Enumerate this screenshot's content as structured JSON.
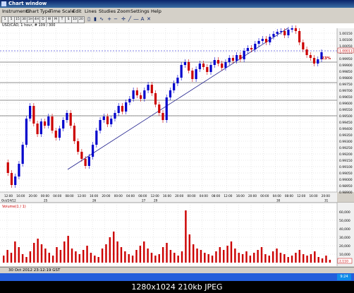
{
  "window": {
    "title": "Chart window"
  },
  "menu": [
    "Instruments",
    "Chart Type",
    "Time Scale",
    "Edit",
    "Lines",
    "Studies",
    "Zoom",
    "Settings",
    "Help"
  ],
  "toolbar": {
    "timeframes": [
      "1",
      "5",
      "15",
      "30",
      "1H",
      "4H",
      "D",
      "W",
      "M",
      "T",
      "S",
      "10",
      "20"
    ]
  },
  "chart": {
    "info": "USD/CAD, 1 hour, # 109 / 300",
    "price_labels": [
      "1.00150",
      "1.00100",
      "1.00050",
      "1.00000",
      "0.99950",
      "0.99900",
      "0.99850",
      "0.99800",
      "0.99750",
      "0.99700",
      "0.99650",
      "0.99600",
      "0.99550",
      "0.99500",
      "0.99450",
      "0.99400",
      "0.99350",
      "0.99300",
      "0.99250",
      "0.99200",
      "0.99150",
      "0.99100",
      "0.99050",
      "0.99000",
      "0.98950",
      "0.98900"
    ],
    "current_price": "1.00011",
    "annotation": "23%",
    "time_labels": [
      "12:00",
      "16:00",
      "20:00",
      "00:00",
      "04:00",
      "08:00",
      "12:00",
      "16:00",
      "20:00",
      "00:00",
      "04:00",
      "08:00",
      "12:00",
      "16:00",
      "20:00",
      "00:00",
      "04:00",
      "08:00",
      "12:00",
      "16:00",
      "20:00",
      "00:00",
      "04:00",
      "08:00",
      "12:00",
      "16:00",
      "20:00"
    ],
    "date_labels": [
      "Oct/24/12",
      "25",
      "26",
      "27",
      "29",
      "30",
      "31"
    ],
    "bull_color": "#0000cc",
    "bear_color": "#cc0000",
    "trendline_color": "#1e1e8c"
  },
  "volume": {
    "title": "Volume(1 / 1)",
    "labels": [
      "60,000",
      "50,000",
      "40,000",
      "30,000",
      "20,000",
      "10,000"
    ],
    "last_value": "2,110",
    "bar_color": "#cc0000"
  },
  "status": {
    "text": "30 Oct 2012 23:12:19 GST"
  },
  "taskbar": {
    "clock": "9:24 PM"
  },
  "viewer": {
    "caption": "1280x1024  210kb  JPEG"
  }
}
